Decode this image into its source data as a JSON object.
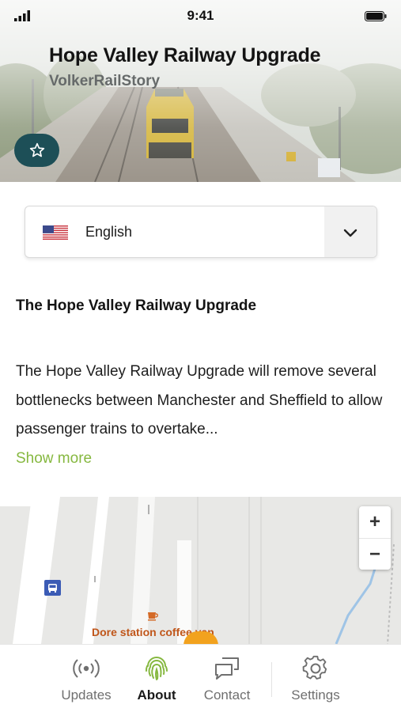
{
  "status_bar": {
    "time": "9:41"
  },
  "hero": {
    "title": "Hope Valley Railway Upgrade",
    "subtitle": "VolkerRailStory"
  },
  "favorite_button": {
    "icon": "star-icon",
    "color": "#1d4f57"
  },
  "language_select": {
    "flag": "us-flag-icon",
    "selected": "English",
    "icon": "chevron-down-icon"
  },
  "article": {
    "heading": "The Hope Valley Railway Upgrade",
    "body": "The Hope Valley Railway Upgrade will remove several bottlenecks between Manchester and Sheffield to allow passenger trains to overtake...",
    "show_more": "Show more",
    "accent": "#86b840"
  },
  "map": {
    "zoom_in": "+",
    "zoom_out": "−",
    "poi_label": "Dore station coffee van",
    "poi_color": "#c0561a"
  },
  "tabs": [
    {
      "label": "Updates",
      "icon": "broadcast-icon",
      "active": false
    },
    {
      "label": "About",
      "icon": "fingerprint-icon",
      "active": true
    },
    {
      "label": "Contact",
      "icon": "chat-icon",
      "active": false
    },
    {
      "label": "Settings",
      "icon": "gear-icon",
      "active": false
    }
  ]
}
